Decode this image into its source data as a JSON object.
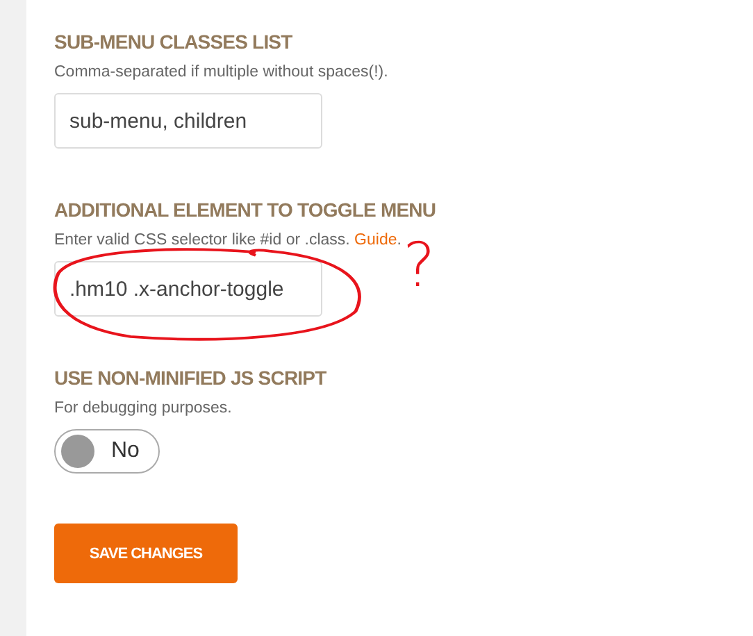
{
  "sections": [
    {
      "kind": "text",
      "title": "SUB-MENU CLASSES LIST",
      "description": "Comma-separated if multiple without spaces(!).",
      "value": "sub-menu, children",
      "annotated": false
    },
    {
      "kind": "text",
      "title": "ADDITIONAL ELEMENT TO TOGGLE MENU",
      "description": "Enter valid CSS selector like #id or .class.",
      "link": "Guide",
      "link_suffix": ".",
      "value": ".hm10 .x-anchor-toggle",
      "annotated": true,
      "annotation_mark": "?"
    },
    {
      "kind": "toggle",
      "title": "USE NON-MINIFIED JS SCRIPT",
      "description": "For debugging purposes.",
      "on": false,
      "state_label": "No"
    }
  ],
  "save_button": "SAVE CHANGES"
}
